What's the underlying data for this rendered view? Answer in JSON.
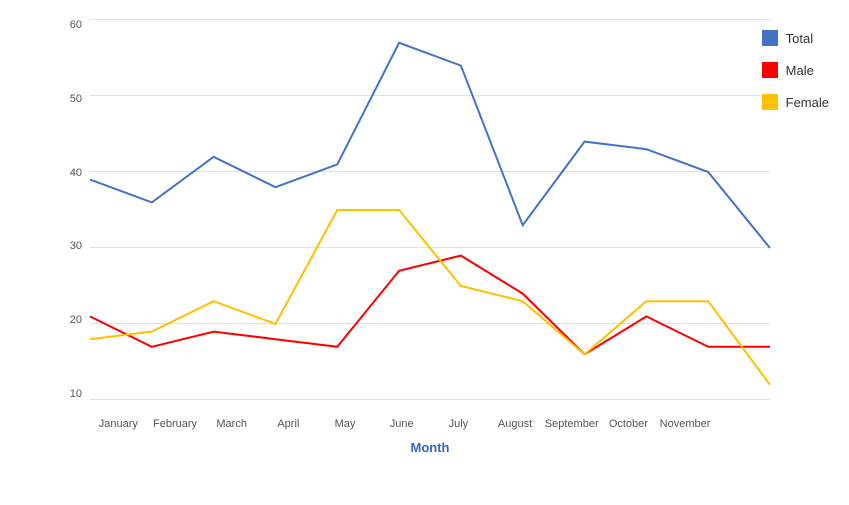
{
  "chart": {
    "title": "Month",
    "yAxis": {
      "labels": [
        "10",
        "20",
        "30",
        "40",
        "50",
        "60"
      ],
      "min": 10,
      "max": 60,
      "step": 10
    },
    "xAxis": {
      "labels": [
        "January",
        "February",
        "March",
        "April",
        "May",
        "June",
        "July",
        "August",
        "September",
        "October",
        "November",
        ""
      ]
    },
    "series": {
      "total": {
        "name": "Total",
        "color": "#4472C4",
        "data": [
          39,
          36,
          42,
          38,
          41,
          57,
          54,
          33,
          44,
          43,
          40,
          30
        ]
      },
      "male": {
        "name": "Male",
        "color": "#FF0000",
        "data": [
          21,
          17,
          19,
          18,
          17,
          27,
          29,
          24,
          16,
          21,
          17,
          17
        ]
      },
      "female": {
        "name": "Female",
        "color": "#FFC000",
        "data": [
          18,
          19,
          23,
          20,
          35,
          35,
          25,
          23,
          16,
          23,
          23,
          12
        ]
      }
    },
    "legend": {
      "items": [
        {
          "label": "Total",
          "color": "#4472C4"
        },
        {
          "label": "Male",
          "color": "#FF0000"
        },
        {
          "label": "Female",
          "color": "#FFC000"
        }
      ]
    }
  }
}
